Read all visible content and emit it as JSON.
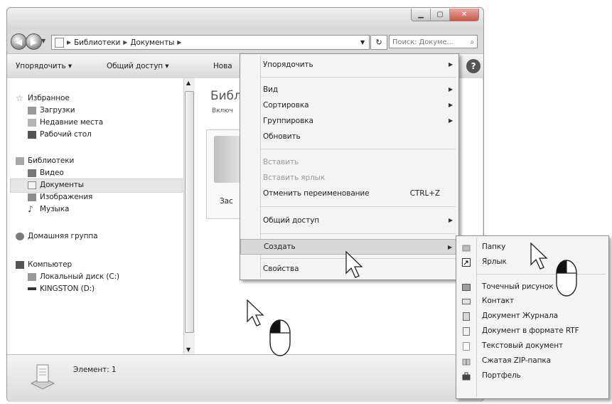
{
  "window": {
    "address": {
      "root_icon": "library-icon",
      "crumbs": [
        "Библиотеки",
        "Документы"
      ]
    },
    "search_placeholder": "Поиск: Докуме...",
    "toolbar": {
      "organize": "Упорядочить ▾",
      "share": "Общий доступ ▾",
      "new_partial": "Нова"
    },
    "nav": {
      "favorites": "Избранное",
      "downloads": "Загрузки",
      "recent": "Недавние места",
      "desktop": "Рабочий стол",
      "libraries": "Библиотеки",
      "video": "Видео",
      "documents": "Документы",
      "images": "Изображения",
      "music": "Музыка",
      "homegroup": "Домашняя группа",
      "computer": "Компьютер",
      "local_disk": "Локальный диск (C:)",
      "kingston": "KINGSTON (D:)"
    },
    "content": {
      "title_partial": "Библ",
      "subtitle_partial": "Включ",
      "folder_label_partial": "Зас"
    },
    "status": {
      "text": "Элемент: 1"
    }
  },
  "context_menu": {
    "items": [
      {
        "label": "Упорядочить",
        "submenu": true
      },
      {
        "label": "Вид",
        "submenu": true
      },
      {
        "label": "Сортировка",
        "submenu": true
      },
      {
        "label": "Группировка",
        "submenu": true
      },
      {
        "label": "Обновить"
      },
      {
        "label": "Вставить",
        "disabled": true
      },
      {
        "label": "Вставить ярлык",
        "disabled": true
      },
      {
        "label": "Отменить переименование",
        "shortcut": "CTRL+Z"
      },
      {
        "label": "Общий доступ",
        "submenu": true
      },
      {
        "label": "Создать",
        "submenu": true,
        "highlighted": true
      },
      {
        "label": "Свойства"
      }
    ]
  },
  "submenu": {
    "items": [
      {
        "label": "Папку",
        "icon": "folder-icon"
      },
      {
        "label": "Ярлык",
        "icon": "shortcut-icon"
      },
      {
        "label": "Точечный рисунок",
        "icon": "bitmap-icon"
      },
      {
        "label": "Контакт",
        "icon": "contact-icon"
      },
      {
        "label": "Документ Журнала",
        "icon": "journal-icon"
      },
      {
        "label": "Документ в формате RTF",
        "icon": "rtf-icon"
      },
      {
        "label": "Текстовый документ",
        "icon": "text-doc-icon"
      },
      {
        "label": "Сжатая ZIP-папка",
        "icon": "zip-folder-icon"
      },
      {
        "label": "Портфель",
        "icon": "briefcase-icon"
      }
    ]
  }
}
